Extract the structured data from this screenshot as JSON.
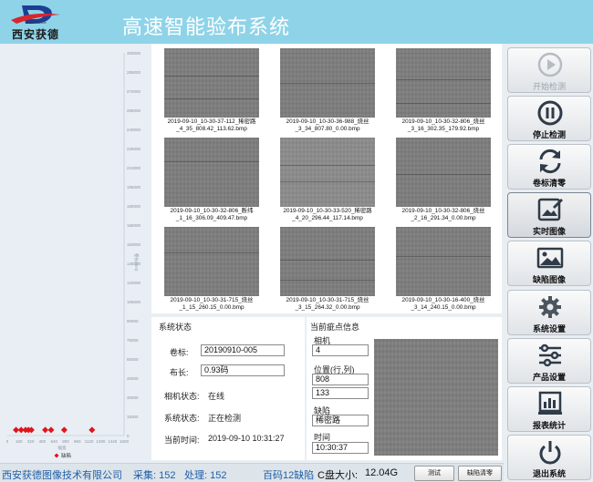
{
  "header": {
    "logo_text": "西安获德",
    "logo_sub": "Xian HuoDe",
    "title": "高速智能验布系统"
  },
  "chart_data": {
    "type": "scatter",
    "ylabel": "卷长(mm)",
    "xlabel": "幅宽",
    "y_ticks": [
      "300000",
      "285000",
      "270000",
      "255000",
      "240000",
      "225000",
      "210000",
      "195000",
      "180000",
      "165000",
      "150000",
      "135000",
      "120000",
      "105000",
      "90000",
      "75000",
      "60000",
      "45000",
      "30000",
      "15000",
      "0"
    ],
    "x_ticks": [
      "0",
      "160",
      "320",
      "480",
      "640",
      "800",
      "960",
      "1120",
      "1280",
      "1440",
      "1600"
    ],
    "xlim": [
      0,
      1600
    ],
    "ylim": [
      0,
      300000
    ],
    "legend": "缺陷",
    "marker_color": "#e0141c",
    "points": [
      {
        "x": 120,
        "y": 1500
      },
      {
        "x": 190,
        "y": 1500
      },
      {
        "x": 250,
        "y": 1500
      },
      {
        "x": 290,
        "y": 1500
      },
      {
        "x": 330,
        "y": 1500
      },
      {
        "x": 520,
        "y": 1500
      },
      {
        "x": 600,
        "y": 1500
      },
      {
        "x": 780,
        "y": 1500
      },
      {
        "x": 1160,
        "y": 1500
      }
    ]
  },
  "images": [
    {
      "caption_line1": "2019-09-10_10-30-37-112_稀密路",
      "caption_line2": "_4_35_808.42_113.62.bmp"
    },
    {
      "caption_line1": "2019-09-10_10-30-36-988_烧丝",
      "caption_line2": "_3_34_807.80_0.00.bmp"
    },
    {
      "caption_line1": "2019-09-10_10-30-32-806_烧丝",
      "caption_line2": "_3_16_302.35_179.92.bmp"
    },
    {
      "caption_line1": "2019-09-10_10-30-32-806_断纬",
      "caption_line2": "_1_16_306.09_409.47.bmp"
    },
    {
      "caption_line1": "2019-09-10_10-30-33-520_稀密路",
      "caption_line2": "_4_20_296.44_117.14.bmp"
    },
    {
      "caption_line1": "2019-09-10_10-30-32-806_烧丝",
      "caption_line2": "_2_16_291.34_0.00.bmp"
    },
    {
      "caption_line1": "2019-09-10_10-30-31-715_烧丝",
      "caption_line2": "_1_15_260.15_0.00.bmp"
    },
    {
      "caption_line1": "2019-09-10_10-30-31-715_烧丝",
      "caption_line2": "_3_15_264.32_0.00.bmp"
    },
    {
      "caption_line1": "2019-09-10_10-30-16-400_烧丝",
      "caption_line2": "_3_14_240.15_0.00.bmp"
    }
  ],
  "status": {
    "title": "系统状态",
    "roll_label": "卷标:",
    "roll_value": "20190910-005",
    "length_label": "布长:",
    "length_value": "0.93码",
    "camera_label": "相机状态:",
    "camera_value": "在线",
    "system_label": "系统状态:",
    "system_value": "正在检测",
    "time_label": "当前时间:",
    "time_value": "2019-09-10 10:31:27"
  },
  "defect": {
    "title": "当前疵点信息",
    "camera_label": "相机",
    "camera_value": "4",
    "position_label": "位置(行,列)",
    "row_value": "808",
    "col_value": "133",
    "defect_label": "缺陷",
    "defect_value": "稀密路",
    "time_label": "时间",
    "time_value": "10:30:37"
  },
  "toolbar": {
    "start": "开始检测",
    "stop": "停止检测",
    "reset": "卷标清零",
    "realtime": "实时图像",
    "defect_images": "缺陷图像",
    "system_settings": "系统设置",
    "product_settings": "产品设置",
    "report": "报表统计",
    "exit": "退出系统"
  },
  "footer": {
    "company": "西安获德图像技术有限公司",
    "collect": "采集: 152",
    "process": "处理: 152",
    "defect_count": "百码12缺陷",
    "disk_label": "C盘大小:",
    "disk_value": "12.04G",
    "test_button": "测试",
    "clear_button": "缺陷清零"
  }
}
